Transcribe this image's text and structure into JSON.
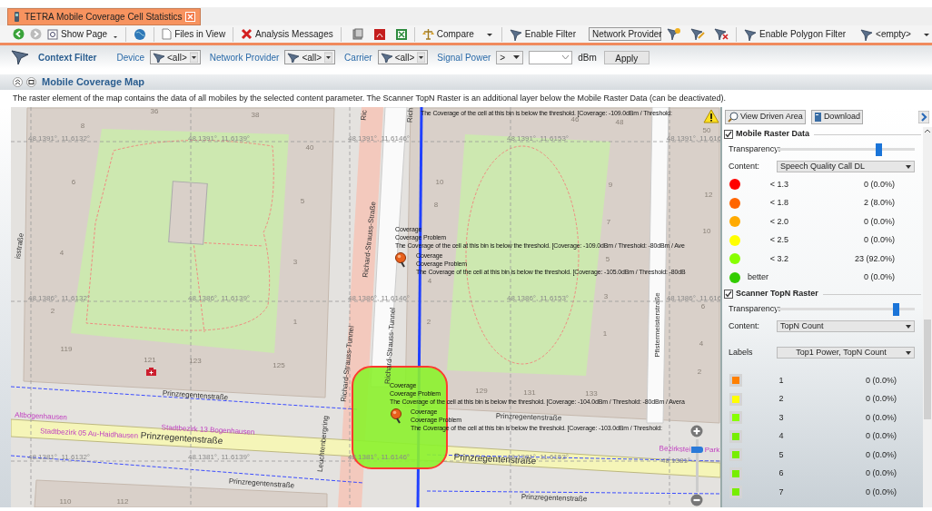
{
  "tab": {
    "title": "TETRA Mobile Coverage Cell Statistics",
    "selected": true
  },
  "toolbar": {
    "show_page": "Show Page",
    "files_in_view": "Files in View",
    "analysis_messages": "Analysis Messages",
    "compare": "Compare",
    "enable_filter": "Enable Filter",
    "provider_select": "Network Provider",
    "enable_polygon_filter": "Enable Polygon Filter",
    "polygon_select": "<empty>"
  },
  "context_filter": {
    "title": "Context Filter",
    "filters": [
      {
        "label": "Device",
        "value": "<all>"
      },
      {
        "label": "Network Provider",
        "value": "<all>"
      },
      {
        "label": "Carrier",
        "value": "<all>"
      }
    ],
    "signal_power": {
      "label": "Signal Power",
      "operator": ">",
      "unit": "dBm"
    },
    "apply": "Apply"
  },
  "section": {
    "title": "Mobile Coverage Map",
    "description": "The raster element of the map contains the data of all mobiles by the selected content parameter. The Scanner TopN Raster is an additional layer below the Mobile Raster Data (can be deactivated)."
  },
  "map": {
    "labels": [
      {
        "kind": "street",
        "text": "Prinzregentenstraße"
      },
      {
        "kind": "street",
        "text": "Prinzregentenstraße"
      },
      {
        "kind": "street",
        "text": "Prinzregentenstraße"
      },
      {
        "kind": "street",
        "text": "Prinzregentenstraße"
      },
      {
        "kind": "street",
        "text": "Prinzregentenstraße"
      },
      {
        "kind": "street",
        "text": "Prinzregentenstraße"
      },
      {
        "kind": "street",
        "text": "Richard-Strauss-Straße"
      },
      {
        "kind": "street",
        "text": "Richard-Strauss-Tunnel"
      },
      {
        "kind": "street",
        "text": "Richard-Strauss-Tunnel"
      },
      {
        "kind": "street",
        "text": "Pfistermeisterstraße"
      },
      {
        "kind": "street",
        "text": "Leuchtenbergring"
      },
      {
        "kind": "street",
        "text": "isstraße"
      },
      {
        "kind": "street",
        "text": "Ric"
      },
      {
        "kind": "street",
        "text": "Rich"
      },
      {
        "kind": "district",
        "text": "Altbogenhausen"
      },
      {
        "kind": "district",
        "text": "Stadtbezirk 13 Bogenhausen"
      },
      {
        "kind": "district",
        "text": "Stadtbezirk 05 Au-Haidhausen"
      },
      {
        "kind": "district",
        "text": "Bezirkstei"
      },
      {
        "kind": "district",
        "text": "Park"
      },
      {
        "kind": "coord",
        "text": "48.1391°, 11.6132°"
      },
      {
        "kind": "coord",
        "text": "48.1391°, 11.6139°"
      },
      {
        "kind": "coord",
        "text": "48.1391°, 11.6146°"
      },
      {
        "kind": "coord",
        "text": "48.1391°, 11.6153°"
      },
      {
        "kind": "coord",
        "text": "48.1391°, 11.616"
      },
      {
        "kind": "coord",
        "text": "48.1386°, 11.6132°"
      },
      {
        "kind": "coord",
        "text": "48.1386°, 11.6139°"
      },
      {
        "kind": "coord",
        "text": "48.1386°, 11.6146°"
      },
      {
        "kind": "coord",
        "text": "48.1386°, 11.6153°"
      },
      {
        "kind": "coord",
        "text": "48.1386°, 11.616"
      },
      {
        "kind": "coord",
        "text": "48.1381°, 11.6132°"
      },
      {
        "kind": "coord",
        "text": "48.1381°, 11.6139°"
      },
      {
        "kind": "coord",
        "text": "48.1381°, 11.6146°"
      },
      {
        "kind": "coord",
        "text": "48.1381°, 11.6153°"
      },
      {
        "kind": "coord",
        "text": "48.1381°"
      },
      {
        "kind": "number",
        "text": "36"
      },
      {
        "kind": "number",
        "text": "38"
      },
      {
        "kind": "number",
        "text": "8"
      },
      {
        "kind": "number",
        "text": "40"
      },
      {
        "kind": "number",
        "text": "6"
      },
      {
        "kind": "number",
        "text": "5"
      },
      {
        "kind": "number",
        "text": "4"
      },
      {
        "kind": "number",
        "text": "3"
      },
      {
        "kind": "number",
        "text": "2"
      },
      {
        "kind": "number",
        "text": "1"
      },
      {
        "kind": "number",
        "text": "119"
      },
      {
        "kind": "number",
        "text": "121"
      },
      {
        "kind": "number",
        "text": "123"
      },
      {
        "kind": "number",
        "text": "125"
      },
      {
        "kind": "number",
        "text": "110"
      },
      {
        "kind": "number",
        "text": "112"
      },
      {
        "kind": "number",
        "text": "46"
      },
      {
        "kind": "number",
        "text": "48"
      },
      {
        "kind": "number",
        "text": "50"
      },
      {
        "kind": "number",
        "text": "10"
      },
      {
        "kind": "number",
        "text": "8"
      },
      {
        "kind": "number",
        "text": "9"
      },
      {
        "kind": "number",
        "text": "12"
      },
      {
        "kind": "number",
        "text": "7"
      },
      {
        "kind": "number",
        "text": "10"
      },
      {
        "kind": "number",
        "text": "5"
      },
      {
        "kind": "number",
        "text": "4"
      },
      {
        "kind": "number",
        "text": "3"
      },
      {
        "kind": "number",
        "text": "6"
      },
      {
        "kind": "number",
        "text": "2"
      },
      {
        "kind": "number",
        "text": "1"
      },
      {
        "kind": "number",
        "text": "4"
      },
      {
        "kind": "number",
        "text": "2"
      },
      {
        "kind": "number",
        "text": "129"
      },
      {
        "kind": "number",
        "text": "131"
      },
      {
        "kind": "number",
        "text": "133"
      }
    ],
    "popups": [
      {
        "lines": [
          "The Coverage of the cell at this bin is below the threshold. [Coverage: -109.0dBm / Threshold:"
        ]
      },
      {
        "lines": [
          "Coverage",
          "Coverage Problem",
          "The Coverage of the cell at this bin is below the threshold. [Coverage: -109.0dBm / Threshold: -80dBm / Ave"
        ]
      },
      {
        "lines": [
          "Coverage",
          "Coverage Problem",
          "The Coverage of the cell at this bin is below the threshold. [Coverage: -105.0dBm / Threshold: -80dB"
        ]
      },
      {
        "lines": [
          "Coverage",
          "Coverage Problem",
          "The Coverage of the cell at this bin is below the threshold. [Coverage: -104.0dBm / Threshold: -80dBm / Avera"
        ]
      },
      {
        "lines": [
          "Coverage",
          "Coverage Problem",
          "The Coverage of the cell at this bin is below the threshold. [Coverage: -103.0dBm / Threshold:"
        ]
      }
    ],
    "zoom": {
      "level": 0.85
    }
  },
  "panel": {
    "buttons": [
      "View Driven Area",
      "Download"
    ],
    "layers": [
      {
        "kind": "dot",
        "title": "Mobile Raster Data",
        "checked": true,
        "transparency_label": "Transparency:",
        "level": 0.74,
        "content_label": "Content:",
        "content": "Speech Quality Call DL",
        "legend": [
          {
            "color": "#ff0000",
            "label": "< 1.3",
            "count": "0 (0.0%)"
          },
          {
            "color": "#ff6600",
            "label": "< 1.8",
            "count": "2 (8.0%)"
          },
          {
            "color": "#ffaa00",
            "label": "< 2.0",
            "count": "0 (0.0%)"
          },
          {
            "color": "#ffff00",
            "label": "< 2.5",
            "count": "0 (0.0%)"
          },
          {
            "color": "#88ff00",
            "label": "< 3.2",
            "count": "23 (92.0%)"
          },
          {
            "color": "#33cc00",
            "label": "better",
            "count": "0 (0.0%)"
          }
        ]
      },
      {
        "kind": "square",
        "title": "Scanner TopN Raster",
        "checked": true,
        "transparency_label": "Transparency:",
        "level": 0.86,
        "content_label": "Content:",
        "content": "TopN Count",
        "labels_label": "Labels",
        "labels_value": "Top1 Power, TopN Count",
        "legend": [
          {
            "color": "#ff8000",
            "label": "1",
            "count": "0 (0.0%)"
          },
          {
            "color": "#ffff00",
            "label": "2",
            "count": "0 (0.0%)"
          },
          {
            "color": "#88ff00",
            "label": "3",
            "count": "0 (0.0%)"
          },
          {
            "color": "#77ee00",
            "label": "4",
            "count": "0 (0.0%)"
          },
          {
            "color": "#77ee00",
            "label": "5",
            "count": "0 (0.0%)"
          },
          {
            "color": "#77ee00",
            "label": "6",
            "count": "0 (0.0%)"
          },
          {
            "color": "#77ee00",
            "label": "7",
            "count": "0 (0.0%)"
          }
        ]
      }
    ]
  }
}
